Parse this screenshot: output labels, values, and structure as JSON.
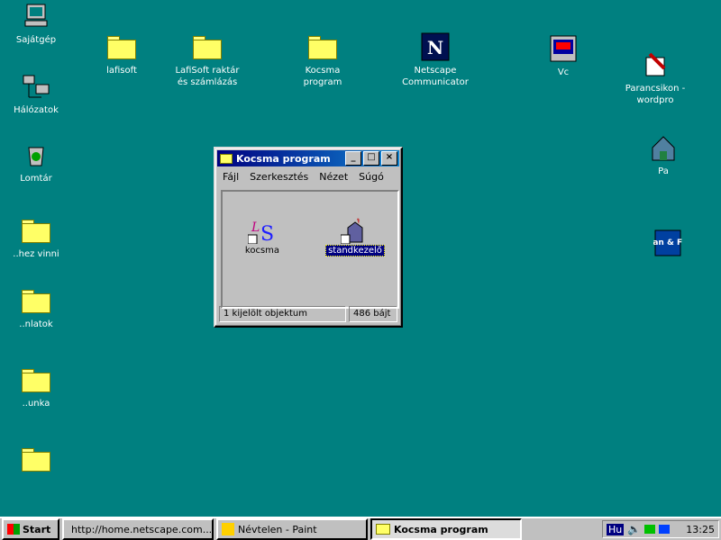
{
  "desktop": {
    "icons": [
      {
        "label": "Sajátgép"
      },
      {
        "label": "Hálózatok"
      },
      {
        "label": "Lomtár"
      },
      {
        "label": "..hez vinni"
      },
      {
        "label": "..nlatok"
      },
      {
        "label": "..unka"
      },
      {
        "label": ""
      },
      {
        "label": "lafisoft"
      },
      {
        "label": "LafiSoft raktár\nés számlázás"
      },
      {
        "label": "Kocsma\nprogram"
      },
      {
        "label": "Netscape\nCommunicator"
      },
      {
        "label": "Vc"
      },
      {
        "label": "Parancsikon -\nwordpro"
      },
      {
        "label": "Pa"
      },
      {
        "label": "Scan & Fun"
      }
    ]
  },
  "window": {
    "title": "Kocsma program",
    "menu": [
      "Fájl",
      "Szerkesztés",
      "Nézet",
      "Súgó"
    ],
    "items": [
      {
        "label": "kocsma"
      },
      {
        "label": "standkezelő"
      }
    ],
    "status_left": "1 kijelölt objektum",
    "status_right": "486 bájt"
  },
  "taskbar": {
    "start": "Start",
    "tasks": [
      "http://home.netscape.com...",
      "Névtelen - Paint",
      "Kocsma program"
    ],
    "lang": "Hu",
    "clock": "13:25"
  }
}
